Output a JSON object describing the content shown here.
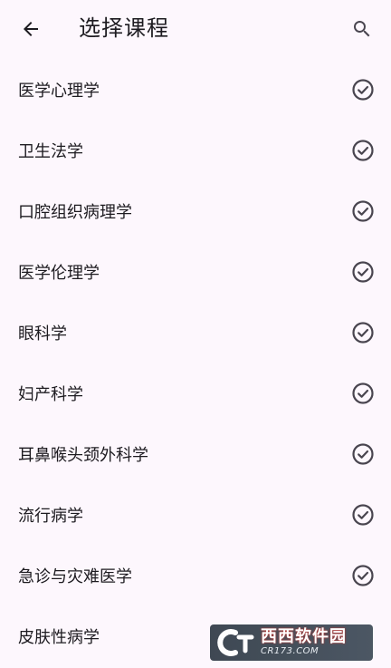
{
  "app_bar": {
    "title": "选择课程",
    "back_icon": "arrow-back-icon",
    "search_icon": "search-icon"
  },
  "courses": [
    {
      "label": "医学心理学",
      "checked": true
    },
    {
      "label": "卫生法学",
      "checked": true
    },
    {
      "label": "口腔组织病理学",
      "checked": true
    },
    {
      "label": "医学伦理学",
      "checked": true
    },
    {
      "label": "眼科学",
      "checked": true
    },
    {
      "label": "妇产科学",
      "checked": true
    },
    {
      "label": "耳鼻喉头颈外科学",
      "checked": true
    },
    {
      "label": "流行病学",
      "checked": true
    },
    {
      "label": "急诊与灾难医学",
      "checked": true
    },
    {
      "label": "皮肤性病学",
      "checked": false
    }
  ],
  "watermark": {
    "brand": "西西软件园",
    "site": "CR173.COM"
  },
  "colors": {
    "background": "#fdf7fd",
    "text": "#1d1b20",
    "icon": "#49454f"
  }
}
